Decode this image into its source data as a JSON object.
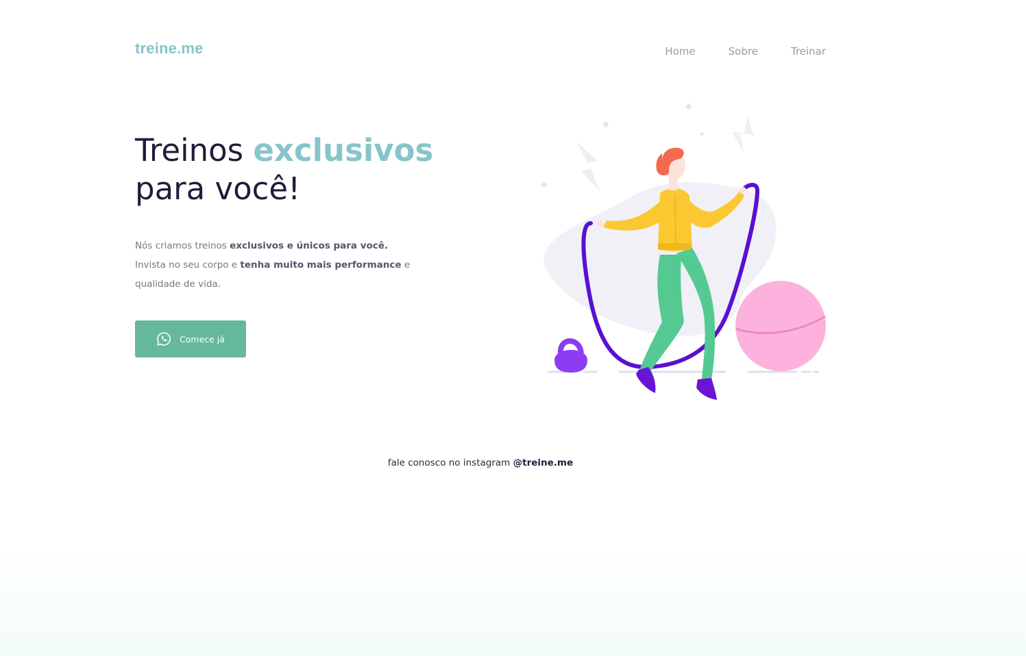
{
  "header": {
    "logo": "treine.me",
    "nav": [
      "Home",
      "Sobre",
      "Treinar"
    ]
  },
  "hero": {
    "title_part1": "Treinos ",
    "title_accent": "exclusivos",
    "title_part2": "para você!",
    "desc_line1_normal": "Nós criamos treinos ",
    "desc_line1_bold": "exclusivos e únicos para você.",
    "desc_line2_normal": "Invista no seu corpo e ",
    "desc_line2_bold": "tenha muito mais performance",
    "desc_line2_end": " e",
    "desc_line3": "qualidade de vida.",
    "cta_label": "Comece já",
    "cta_icon": "whatsapp-icon"
  },
  "footer": {
    "text": "fale conosco no instagram ",
    "handle": "@treine.me"
  },
  "colors": {
    "accent": "#86c5cb",
    "cta": "#66b89b",
    "title": "#1f1d3a"
  }
}
